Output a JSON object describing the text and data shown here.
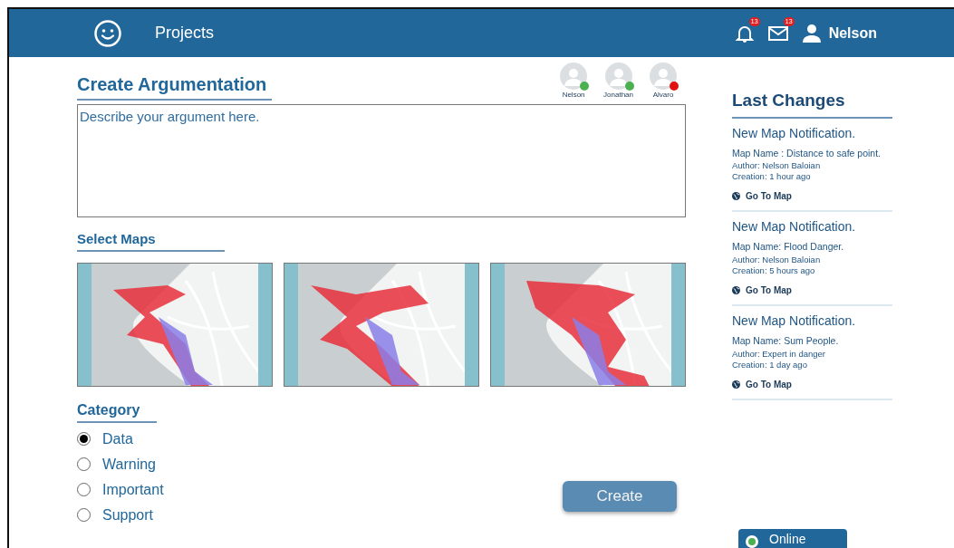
{
  "header": {
    "title": "Projects",
    "notifications_badge": "13",
    "messages_badge": "13",
    "user": "Nelson"
  },
  "form": {
    "title": "Create Argumentation",
    "placeholder": "Describe your argument here.",
    "participants": [
      {
        "name": "Nelson",
        "color": "#4caf50"
      },
      {
        "name": "Jonathan",
        "color": "#4caf50"
      },
      {
        "name": "Alvaro",
        "color": "#e01010"
      }
    ],
    "maps_title": "Select Maps",
    "category_title": "Category",
    "categories": [
      {
        "label": "Data",
        "selected": true
      },
      {
        "label": "Warning",
        "selected": false
      },
      {
        "label": "Important",
        "selected": false
      },
      {
        "label": "Support",
        "selected": false
      }
    ],
    "create_button": "Create"
  },
  "sidebar": {
    "title": "Last Changes",
    "items": [
      {
        "title": "New Map Notification.",
        "map_name": "Map Name : Distance to safe point.",
        "author": "Author: Nelson Baloian",
        "creation": "Creation: 1 hour ago",
        "link": "Go To Map"
      },
      {
        "title": "New Map Notification.",
        "map_name": "Map Name: Flood Danger.",
        "author": "Author:  Nelson Baloian",
        "creation": "Creation: 5 hours ago",
        "link": "Go To Map"
      },
      {
        "title": "New Map Notification.",
        "map_name": "Map Name: Sum People.",
        "author": "Author: Expert in danger",
        "creation": "Creation: 1 day ago",
        "link": "Go To Map"
      }
    ],
    "status": {
      "label": "Online",
      "color": "#4caf50"
    }
  }
}
